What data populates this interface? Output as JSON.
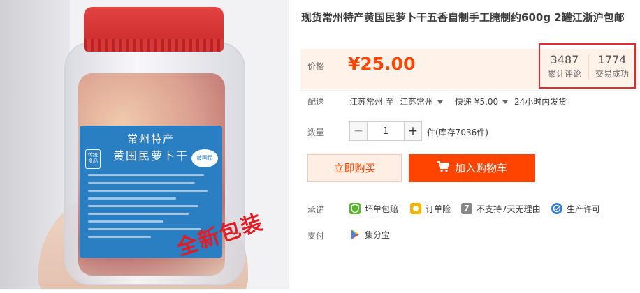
{
  "product": {
    "title": "现货常州特产黄国民萝卜干五香自制手工腌制约600g 2罐江浙沪包邮",
    "photo": {
      "label_line1": "常州特产",
      "label_line2": "黄国民萝卜干",
      "seal_text": "传统食品",
      "brand_mark": "黄国民",
      "stamp_text": "全新包装"
    }
  },
  "price": {
    "label": "价格",
    "value": "¥25.00",
    "color": "#ff4400"
  },
  "stats": {
    "reviews_count": "3487",
    "reviews_label": "累计评论",
    "sales_count": "1774",
    "sales_label": "交易成功",
    "highlight_color": "#e32a2a"
  },
  "delivery": {
    "label": "配送",
    "from": "江苏常州",
    "to_word": "至",
    "to": "江苏常州",
    "shipping": "快递 ¥5.00",
    "dispatch": "24小时内发货"
  },
  "quantity": {
    "label": "数量",
    "value": "1",
    "minus": "−",
    "plus": "+",
    "stock": "件(库存7036件)"
  },
  "actions": {
    "buy_now": "立即购买",
    "add_to_cart": "加入购物车"
  },
  "promise": {
    "label": "承诺",
    "items": [
      {
        "text": "坏单包赔",
        "icon": "shield-icon",
        "color": "#5cb531"
      },
      {
        "text": "订单险",
        "icon": "badge-icon",
        "color": "#f5b400"
      },
      {
        "text": "不支持7天无理由",
        "icon": "seven-icon",
        "color": "#888888"
      },
      {
        "text": "生产许可",
        "icon": "qs-icon",
        "color": "#2e7ad1"
      }
    ]
  },
  "payment": {
    "label": "支付",
    "method": "集分宝",
    "icon": "play-icon"
  }
}
